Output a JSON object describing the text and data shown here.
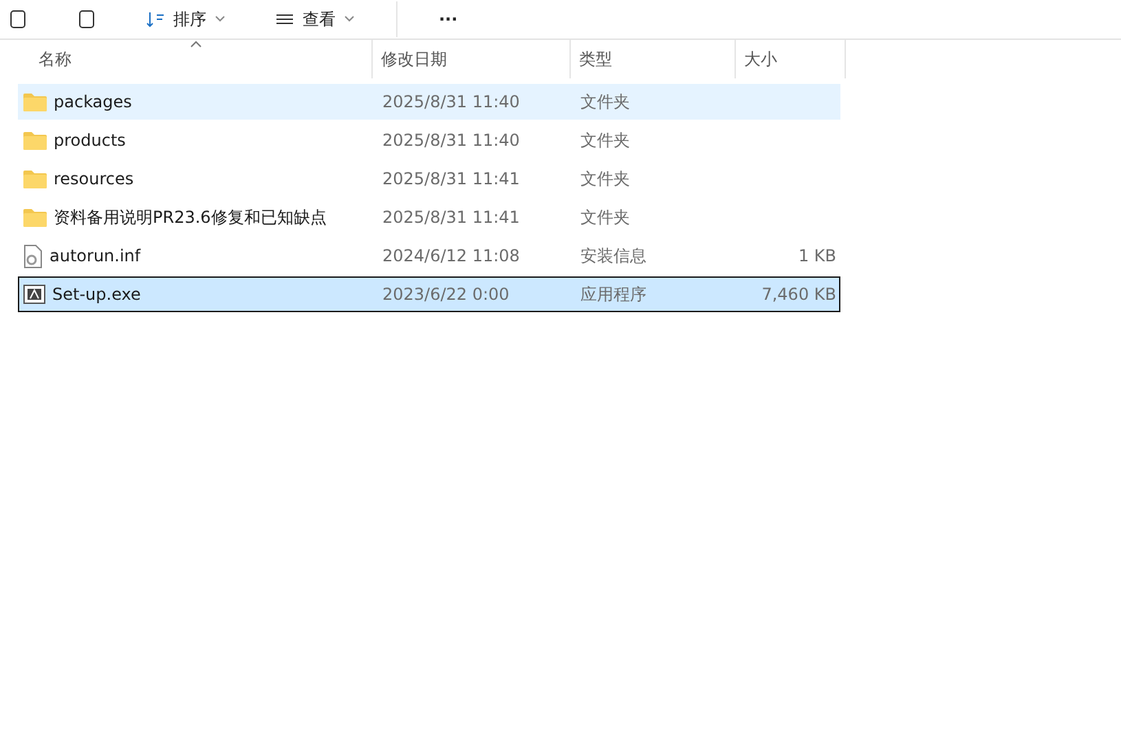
{
  "toolbar": {
    "items": [
      {
        "kind": "icon"
      },
      {
        "kind": "icon"
      },
      {
        "kind": "menu",
        "label": "排序"
      },
      {
        "kind": "menu",
        "label": "查看"
      },
      {
        "kind": "more",
        "label": "···"
      }
    ]
  },
  "table": {
    "columns": [
      {
        "label": "名称",
        "sorted": true
      },
      {
        "label": "修改日期",
        "sorted": false
      },
      {
        "label": "类型",
        "sorted": false
      },
      {
        "label": "大小",
        "sorted": false
      }
    ],
    "rows": [
      {
        "kind": "folder",
        "name": "packages",
        "date": "2025/8/31 11:40",
        "type": "文件夹",
        "hovered": true,
        "selected": false
      },
      {
        "kind": "folder",
        "name": "products",
        "date": "2025/8/31 11:40",
        "type": "文件夹",
        "hovered": false,
        "selected": false
      },
      {
        "kind": "folder",
        "name": "resources",
        "date": "2025/8/31 11:41",
        "type": "文件夹",
        "hovered": false,
        "selected": false
      },
      {
        "kind": "folder",
        "name": "资料备用说明PR23.6修复和已知缺点",
        "date": "2025/8/31 11:41",
        "type": "文件夹",
        "hovered": false,
        "selected": false
      },
      {
        "kind": "settings",
        "name": "autorun.inf",
        "date": "2024/6/12 11:08",
        "type": "安装信息",
        "size": "1 KB",
        "hovered": false,
        "selected": false
      },
      {
        "kind": "app",
        "name": "Set-up.exe",
        "date": "2023/6/22 0:00",
        "type": "应用程序",
        "size": "7,460 KB",
        "hovered": false,
        "selected": true
      }
    ]
  }
}
